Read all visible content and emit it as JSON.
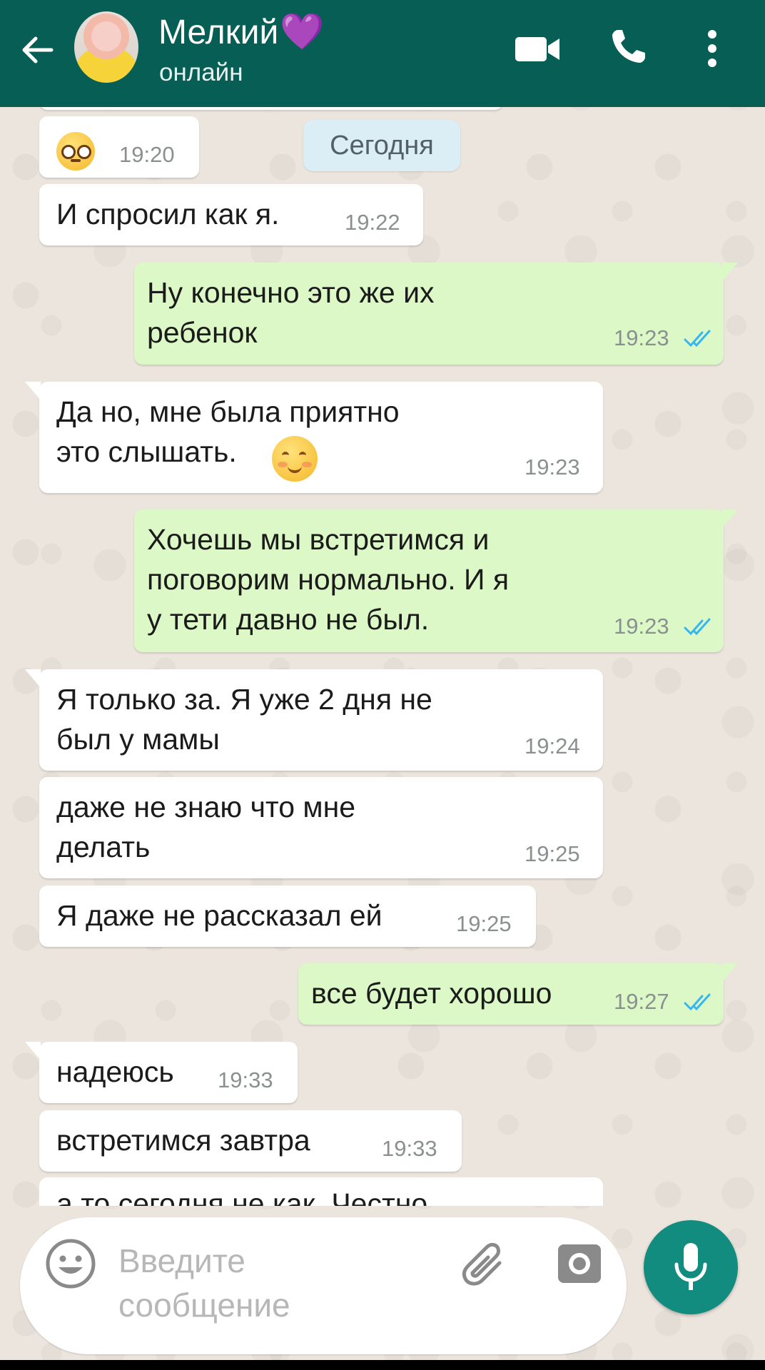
{
  "header": {
    "contact_name": "Мелкий",
    "name_emoji": "💜",
    "status": "онлайн",
    "icons": [
      "back-arrow-icon",
      "video-call-icon",
      "phone-call-icon",
      "more-options-icon"
    ],
    "bg_color": "#075e54"
  },
  "date_chip": "Сегодня",
  "messages": [
    {
      "dir": "in",
      "text": "",
      "emoji": "pleading-face",
      "time": "19:20"
    },
    {
      "dir": "in",
      "text": "И спросил как я.",
      "time": "19:22"
    },
    {
      "dir": "out",
      "text": "Ну конечно это же их\nребенок",
      "time": "19:23",
      "read": true
    },
    {
      "dir": "in",
      "text": "Да но, мне была приятно\nэто слышать.",
      "emoji": "smiling-face",
      "time": "19:23"
    },
    {
      "dir": "out",
      "text": "Хочешь мы встретимся и\nпоговорим нормально. И я\nу тети давно не был.",
      "time": "19:23",
      "read": true
    },
    {
      "dir": "in",
      "text": "Я только за. Я уже 2 дня не\nбыл у мамы",
      "time": "19:24"
    },
    {
      "dir": "in",
      "text": "даже не знаю что мне\nделать",
      "time": "19:25"
    },
    {
      "dir": "in",
      "text": "Я даже не рассказал ей",
      "time": "19:25"
    },
    {
      "dir": "out",
      "text": "все будет хорошо",
      "time": "19:27",
      "read": true
    },
    {
      "dir": "in",
      "text": "надеюсь",
      "time": "19:33"
    },
    {
      "dir": "in",
      "text": "встретимся завтра",
      "time": "19:33"
    },
    {
      "dir": "in",
      "text": "а то сегодня не как. Честно",
      "time": ""
    }
  ],
  "input": {
    "placeholder": "Введите\nсообщение",
    "icons": [
      "emoji-icon",
      "attach-icon",
      "camera-icon",
      "mic-icon"
    ]
  },
  "colors": {
    "incoming_bubble": "#ffffff",
    "outgoing_bubble": "#dcf8c6",
    "read_ticks": "#34b7f1",
    "accent": "#128c7e"
  }
}
